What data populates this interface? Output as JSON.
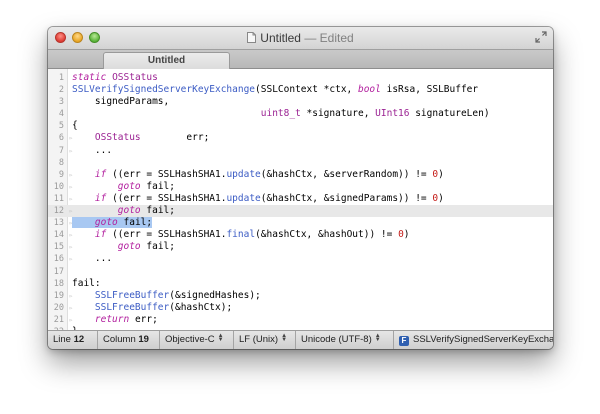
{
  "window": {
    "title": "Untitled",
    "edited_label": "Edited",
    "title_separator": "—"
  },
  "tabs": [
    {
      "label": "Untitled",
      "active": true
    }
  ],
  "editor": {
    "current_line": 12,
    "lines": [
      {
        "n": 1,
        "html": "<span class=\"k\">static</span> <span class=\"ty\">OSStatus</span>"
      },
      {
        "n": 2,
        "html": "<span class=\"fn\">SSLVerifySignedServerKeyExchange</span>(SSLContext *ctx, <span class=\"k\">bool</span> isRsa, SSLBuffer"
      },
      {
        "n": 3,
        "html": "    signedParams,"
      },
      {
        "n": 4,
        "html": "                                 <span class=\"ty\">uint8_t</span> *signature, <span class=\"ty\">UInt16</span> signatureLen)"
      },
      {
        "n": 5,
        "html": "{"
      },
      {
        "n": 6,
        "html": "    <span class=\"ty\">OSStatus</span>        err;"
      },
      {
        "n": 7,
        "html": "    ..."
      },
      {
        "n": 8,
        "html": ""
      },
      {
        "n": 9,
        "html": "    <span class=\"k\">if</span> ((err = SSLHashSHA1.<span class=\"fn\">update</span>(&amp;hashCtx, &amp;serverRandom)) != <span class=\"num\">0</span>)"
      },
      {
        "n": 10,
        "html": "        <span class=\"k\">goto</span> fail;"
      },
      {
        "n": 11,
        "html": "    <span class=\"k\">if</span> ((err = SSLHashSHA1.<span class=\"fn\">update</span>(&amp;hashCtx, &amp;signedParams)) != <span class=\"num\">0</span>)"
      },
      {
        "n": 12,
        "html": "        <span class=\"k\">goto</span> fail;"
      },
      {
        "n": 13,
        "html": "<span class=\"sel\">    <span class=\"k\">goto</span> fail;</span>"
      },
      {
        "n": 14,
        "html": "    <span class=\"k\">if</span> ((err = SSLHashSHA1.<span class=\"fn\">final</span>(&amp;hashCtx, &amp;hashOut)) != <span class=\"num\">0</span>)"
      },
      {
        "n": 15,
        "html": "        <span class=\"k\">goto</span> fail;"
      },
      {
        "n": 16,
        "html": "    ..."
      },
      {
        "n": 17,
        "html": ""
      },
      {
        "n": 18,
        "html": "fail:"
      },
      {
        "n": 19,
        "html": "    <span class=\"fn\">SSLFreeBuffer</span>(&amp;signedHashes);"
      },
      {
        "n": 20,
        "html": "    <span class=\"fn\">SSLFreeBuffer</span>(&amp;hashCtx);"
      },
      {
        "n": 21,
        "html": "    <span class=\"k\">return</span> err;"
      },
      {
        "n": 22,
        "html": "}"
      }
    ]
  },
  "status": {
    "line_label": "Line",
    "line_value": "12",
    "column_label": "Column",
    "column_value": "19",
    "language": "Objective-C",
    "line_endings": "LF (Unix)",
    "encoding": "Unicode (UTF-8)",
    "symbol_icon": "F",
    "symbol": "SSLVerifySignedServerKeyExchange"
  },
  "colors": {
    "keyword": "#b21f9e",
    "type": "#9b2393",
    "function": "#3c5cc4",
    "number": "#c41a16",
    "selection": "#a8c8f2"
  }
}
